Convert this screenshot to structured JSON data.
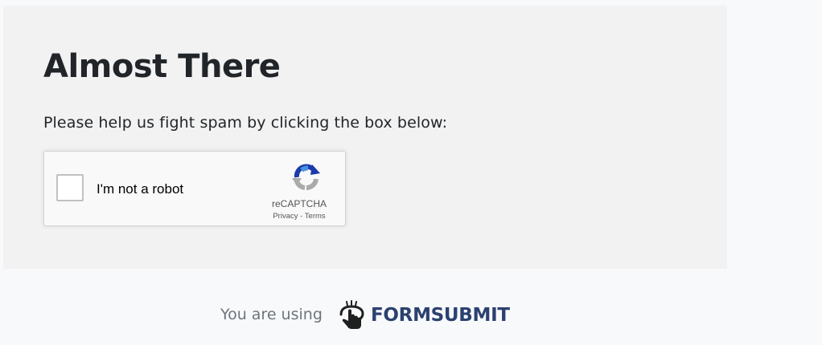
{
  "card": {
    "title": "Almost There",
    "description": "Please help us fight spam by clicking the box below:"
  },
  "captcha": {
    "label": "I'm not a robot",
    "brand": "reCAPTCHA",
    "privacy_link": "Privacy",
    "separator": " - ",
    "terms_link": "Terms",
    "checked": false,
    "logo_icon": "recaptcha-arrows-icon"
  },
  "footer": {
    "prefix": "You are using",
    "brand_name": "FORMSUBMIT",
    "brand_icon": "pointing-hand-icon"
  },
  "colors": {
    "page_bg": "#f8f9fa",
    "card_bg": "#f2f2f2",
    "text": "#212529",
    "muted": "#6c757d",
    "brand": "#2b4170",
    "recaptcha_blue": "#1c3aa9",
    "recaptcha_light_blue": "#4a90e2",
    "recaptcha_gray": "#aaaaaa"
  }
}
